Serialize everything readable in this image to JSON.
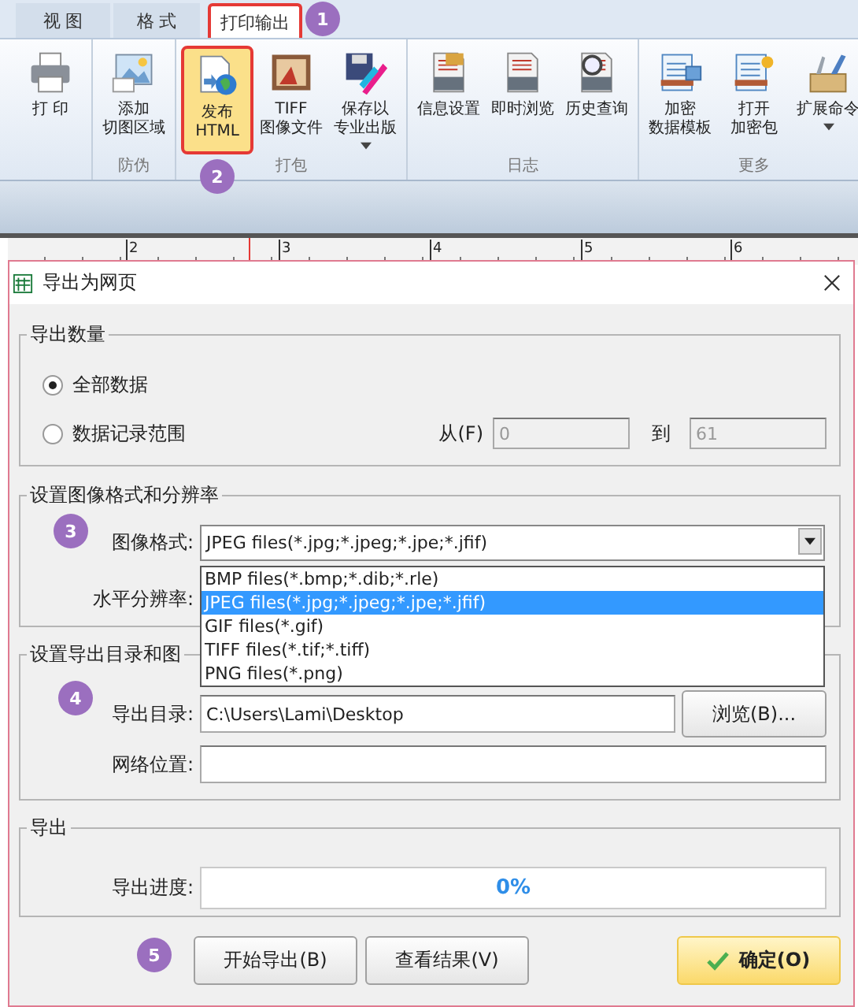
{
  "tabs": [
    {
      "label": "视 图",
      "selected": false
    },
    {
      "label": "格 式",
      "selected": false
    },
    {
      "label": "打印输出",
      "selected": true
    }
  ],
  "ribbon_groups": [
    {
      "buttons": [
        {
          "lines": [
            "打 印"
          ],
          "selected": false
        }
      ]
    },
    {
      "label": "防伪",
      "buttons": [
        {
          "lines": [
            "添加",
            "切图区域"
          ],
          "selected": false
        }
      ]
    },
    {
      "label": "打包",
      "buttons": [
        {
          "lines": [
            "发布",
            "HTML"
          ],
          "selected": true
        },
        {
          "lines": [
            "TIFF",
            "图像文件"
          ],
          "selected": false
        },
        {
          "lines": [
            "保存以",
            "专业出版"
          ],
          "selected": false,
          "dropdown": true
        }
      ]
    },
    {
      "label": "日志",
      "buttons": [
        {
          "lines": [
            "信息设置"
          ],
          "selected": false
        },
        {
          "lines": [
            "即时浏览"
          ],
          "selected": false
        },
        {
          "lines": [
            "历史查询"
          ],
          "selected": false
        }
      ]
    },
    {
      "label": "更多",
      "buttons": [
        {
          "lines": [
            "加密",
            "数据模板"
          ],
          "selected": false
        },
        {
          "lines": [
            "打开",
            "加密包"
          ],
          "selected": false
        },
        {
          "lines": [
            "扩展命令"
          ],
          "selected": false,
          "dropdown": true
        }
      ]
    }
  ],
  "ruler": {
    "labels": [
      "2",
      "3",
      "4",
      "5",
      "6"
    ]
  },
  "callouts": [
    "1",
    "2",
    "3",
    "4",
    "5"
  ],
  "dialog": {
    "title": "导出为网页",
    "count_group": {
      "title": "导出数量",
      "options": [
        {
          "label": "全部数据",
          "selected": true
        },
        {
          "label": "数据记录范围",
          "selected": false
        }
      ],
      "from_label": "从(F)",
      "from_value": "0",
      "to_label": "到",
      "to_value": "61"
    },
    "format_group": {
      "title": "设置图像格式和分辨率",
      "format_label": "图像格式:",
      "format_value": "JPEG files(*.jpg;*.jpeg;*.jpe;*.jfif)",
      "resolution_label": "水平分辨率:",
      "options": [
        {
          "label": "BMP files(*.bmp;*.dib;*.rle)",
          "selected": false
        },
        {
          "label": "JPEG files(*.jpg;*.jpeg;*.jpe;*.jfif)",
          "selected": true
        },
        {
          "label": "GIF files(*.gif)",
          "selected": false
        },
        {
          "label": "TIFF files(*.tif;*.tiff)",
          "selected": false
        },
        {
          "label": "PNG files(*.png)",
          "selected": false
        }
      ]
    },
    "dir_group": {
      "title": "设置导出目录和图",
      "dir_label": "导出目录:",
      "dir_value": "C:\\Users\\Lami\\Desktop",
      "browse": "浏览(B)...",
      "network_label": "网络位置:"
    },
    "export_group": {
      "title": "导出",
      "progress_label": "导出进度:",
      "progress_text": "0%",
      "level": 0
    },
    "buttons": [
      {
        "label": "开始导出(B)",
        "primary": false
      },
      {
        "label": "查看结果(V)",
        "primary": false
      },
      {
        "label": "确定(O)",
        "primary": true
      }
    ]
  }
}
